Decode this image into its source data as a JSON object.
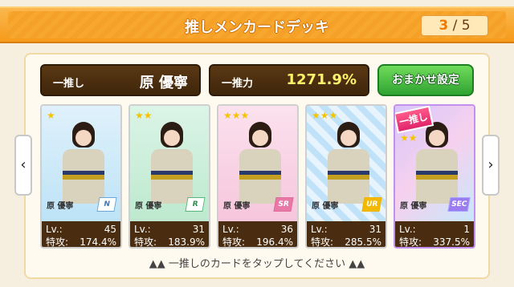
{
  "header": {
    "title": "推しメンカードデッキ",
    "page_current": "3",
    "page_separator": "/",
    "page_total": "5"
  },
  "info": {
    "oshi_label": "一推し",
    "oshi_value": "原 優寧",
    "power_label": "一推力",
    "power_value": "1271.9%"
  },
  "omakase_label": "おまかせ設定",
  "nav": {
    "left": "‹",
    "right": "›"
  },
  "cards": [
    {
      "stars": "★",
      "name": "原 優寧",
      "rarity": "N",
      "lv_label": "Lv.:",
      "lv": "45",
      "sk_label": "特攻:",
      "sk": "174.4%"
    },
    {
      "stars": "★★",
      "name": "原 優寧",
      "rarity": "R",
      "lv_label": "Lv.:",
      "lv": "31",
      "sk_label": "特攻:",
      "sk": "183.9%"
    },
    {
      "stars": "★★★",
      "name": "原 優寧",
      "rarity": "SR",
      "lv_label": "Lv.:",
      "lv": "36",
      "sk_label": "特攻:",
      "sk": "196.4%"
    },
    {
      "stars": "★★★",
      "name": "原 優寧",
      "rarity": "UR",
      "lv_label": "Lv.:",
      "lv": "31",
      "sk_label": "特攻:",
      "sk": "285.5%"
    },
    {
      "stars": "★★",
      "name": "原 優寧",
      "rarity": "SEC",
      "lv_label": "Lv.:",
      "lv": "1",
      "sk_label": "特攻:",
      "sk": "337.5%",
      "badge": "一推し"
    }
  ],
  "hint": "▲▲ 一推しのカードをタップしてください ▲▲"
}
